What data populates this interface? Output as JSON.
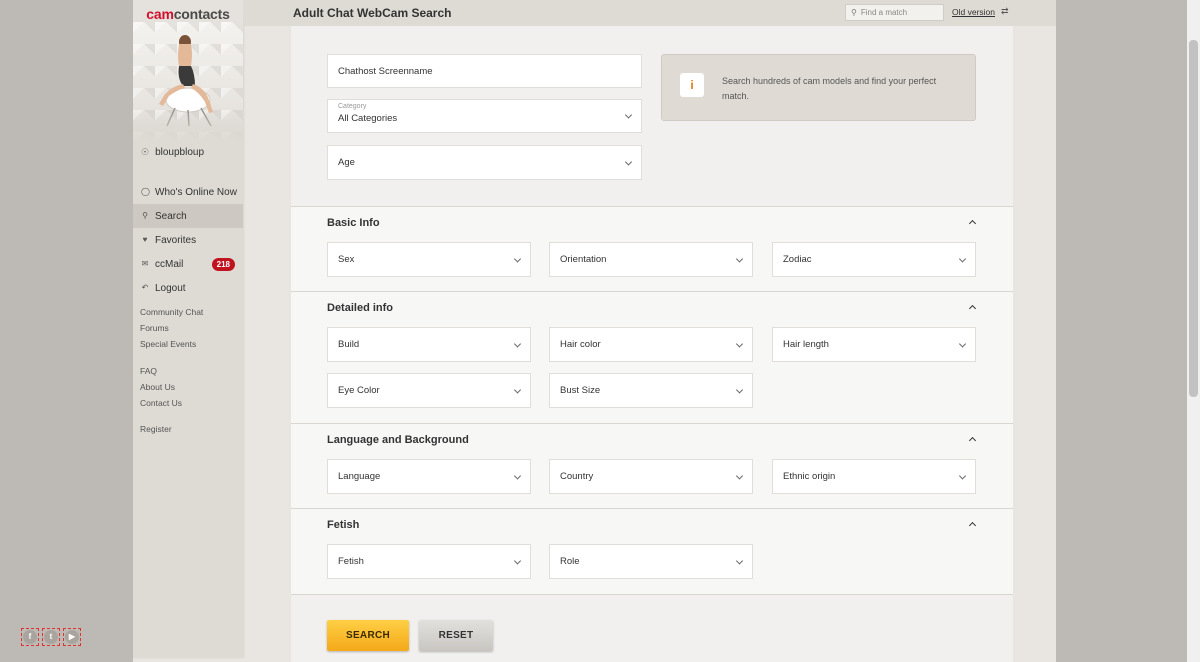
{
  "brand": {
    "part1": "cam",
    "part2": "contacts"
  },
  "page_title": "Adult Chat WebCam Search",
  "search_box": {
    "placeholder": "Find a match"
  },
  "old_version_label": "Old version",
  "sidebar": {
    "username": "bloupbloup",
    "nav": [
      {
        "label": "Who's Online Now",
        "icon": "bulb-icon"
      },
      {
        "label": "Search",
        "icon": "search-icon",
        "active": true
      },
      {
        "label": "Favorites",
        "icon": "heart-icon"
      },
      {
        "label": "ccMail",
        "icon": "mail-icon",
        "badge": "218"
      },
      {
        "label": "Logout",
        "icon": "logout-icon"
      }
    ],
    "links_group1": [
      "Community Chat",
      "Forums",
      "Special Events"
    ],
    "links_group2": [
      "FAQ",
      "About Us",
      "Contact Us"
    ],
    "links_group3": [
      "Register"
    ],
    "social": [
      "facebook-icon",
      "twitter-icon",
      "youtube-icon"
    ]
  },
  "top_fields": {
    "screenname": "Chathost Screenname",
    "category_label": "Category",
    "category_value": "All Categories",
    "age": "Age"
  },
  "info": {
    "text": "Search hundreds of cam models and find your perfect match."
  },
  "sections": {
    "basic": {
      "title": "Basic Info",
      "fields": [
        "Sex",
        "Orientation",
        "Zodiac"
      ]
    },
    "detailed": {
      "title": "Detailed info",
      "fields": [
        "Build",
        "Hair color",
        "Hair length",
        "Eye Color",
        "Bust Size"
      ]
    },
    "language": {
      "title": "Language and Background",
      "fields": [
        "Language",
        "Country",
        "Ethnic origin"
      ]
    },
    "fetish": {
      "title": "Fetish",
      "fields": [
        "Fetish",
        "Role"
      ]
    }
  },
  "buttons": {
    "search": "SEARCH",
    "reset": "RESET"
  },
  "colors": {
    "accent": "#d0102b",
    "button_search": "#f4a91a",
    "badge": "#c0131f"
  }
}
